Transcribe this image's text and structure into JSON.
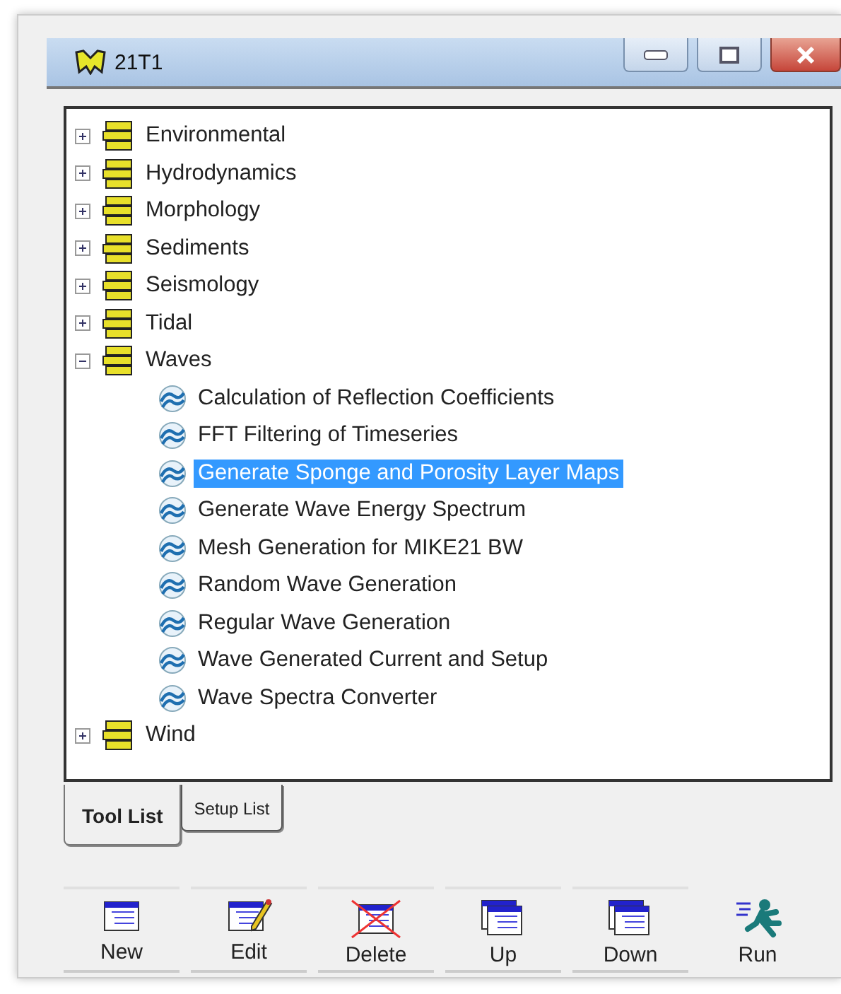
{
  "window": {
    "title": "21T1"
  },
  "tree": [
    {
      "label": "Environmental",
      "expanded": false
    },
    {
      "label": "Hydrodynamics",
      "expanded": false
    },
    {
      "label": "Morphology",
      "expanded": false
    },
    {
      "label": "Sediments",
      "expanded": false
    },
    {
      "label": "Seismology",
      "expanded": false
    },
    {
      "label": "Tidal",
      "expanded": false
    },
    {
      "label": "Waves",
      "expanded": true,
      "children": [
        {
          "label": "Calculation of Reflection Coefficients",
          "selected": false
        },
        {
          "label": "FFT Filtering of Timeseries",
          "selected": false
        },
        {
          "label": "Generate Sponge and Porosity Layer Maps",
          "selected": true
        },
        {
          "label": "Generate Wave Energy Spectrum",
          "selected": false
        },
        {
          "label": "Mesh Generation for MIKE21 BW",
          "selected": false
        },
        {
          "label": "Random Wave Generation",
          "selected": false
        },
        {
          "label": "Regular Wave Generation",
          "selected": false
        },
        {
          "label": "Wave Generated Current and Setup",
          "selected": false
        },
        {
          "label": "Wave Spectra Converter",
          "selected": false
        }
      ]
    },
    {
      "label": "Wind",
      "expanded": false
    }
  ],
  "tabs": [
    {
      "label": "Tool List",
      "selected": true
    },
    {
      "label": "Setup List",
      "selected": false
    }
  ],
  "buttons": [
    {
      "label": "New",
      "kind": "new"
    },
    {
      "label": "Edit",
      "kind": "edit"
    },
    {
      "label": "Delete",
      "kind": "delete"
    },
    {
      "label": "Up",
      "kind": "up"
    },
    {
      "label": "Down",
      "kind": "down"
    },
    {
      "label": "Run",
      "kind": "run"
    }
  ]
}
